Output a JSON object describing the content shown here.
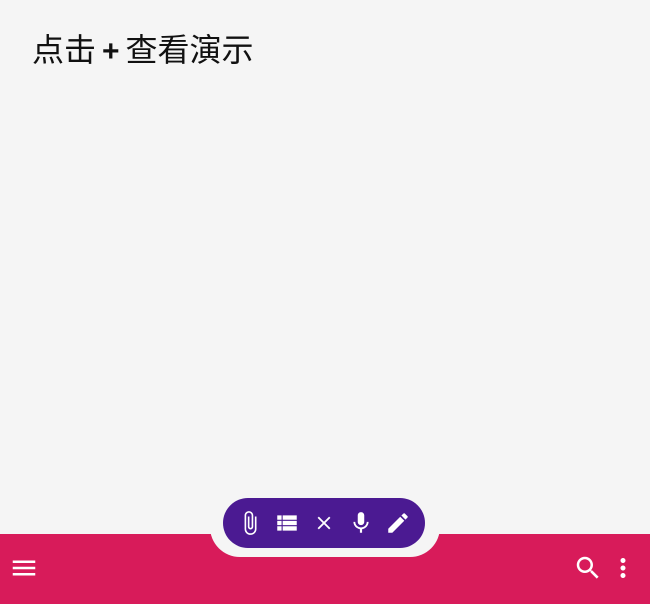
{
  "instruction": {
    "before": "点击",
    "plus": "+",
    "after": "查看演示"
  },
  "fab_actions": [
    {
      "name": "attach",
      "icon": "paperclip-icon"
    },
    {
      "name": "list",
      "icon": "view-list-icon"
    },
    {
      "name": "close",
      "icon": "close-icon"
    },
    {
      "name": "voice",
      "icon": "microphone-icon"
    },
    {
      "name": "edit",
      "icon": "pencil-icon"
    }
  ],
  "bottom_bar": {
    "left_icon": "menu-icon",
    "right_icons": [
      "search-icon",
      "more-vertical-icon"
    ]
  },
  "colors": {
    "background": "#f5f5f5",
    "bottom_bar": "#d81b5a",
    "fab": "#4b1a92",
    "icon": "#ffffff",
    "text": "#111111"
  }
}
